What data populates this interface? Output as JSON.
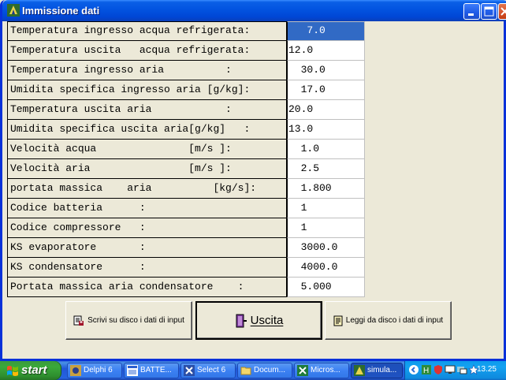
{
  "window": {
    "title": "Immissione dati"
  },
  "rows": [
    {
      "label": "Temperatura ingresso acqua refrigerata:",
      "value": "   7.0"
    },
    {
      "label": "Temperatura uscita   acqua refrigerata:",
      "value": "12.0"
    },
    {
      "label": "Temperatura ingresso aria          :",
      "value": "  30.0"
    },
    {
      "label": "Umidita specifica ingresso aria [g/kg]:",
      "value": "  17.0"
    },
    {
      "label": "Temperatura uscita aria            :",
      "value": "20.0"
    },
    {
      "label": "Umidita specifica uscita aria[g/kg]   :",
      "value": "13.0"
    },
    {
      "label": "Velocità acqua               [m/s ]:",
      "value": "  1.0"
    },
    {
      "label": "Velocità aria                [m/s ]:",
      "value": "  2.5"
    },
    {
      "label": "portata massica    aria          [kg/s]:",
      "value": "  1.800"
    },
    {
      "label": "Codice batteria      :",
      "value": "  1"
    },
    {
      "label": "Codice compressore   :",
      "value": "  1"
    },
    {
      "label": "KS evaporatore       :",
      "value": "  3000.0"
    },
    {
      "label": "KS condensatore      :",
      "value": "  4000.0"
    },
    {
      "label": "Portata massica aria condensatore    :",
      "value": "  5.000"
    }
  ],
  "buttons": {
    "write": "Scrivi su disco i dati di input",
    "exit": "Uscita",
    "read": "Leggi da disco i dati di input"
  },
  "taskbar": {
    "start": "start",
    "tasks": [
      "Delphi 6",
      "BATTE...",
      "Select 6",
      "Docum...",
      "Micros...",
      "simula..."
    ],
    "clock": "13.25"
  },
  "colors": {
    "selection": "#316AC5",
    "titlebar": "#0054E3",
    "start_green": "#3AA93A"
  }
}
